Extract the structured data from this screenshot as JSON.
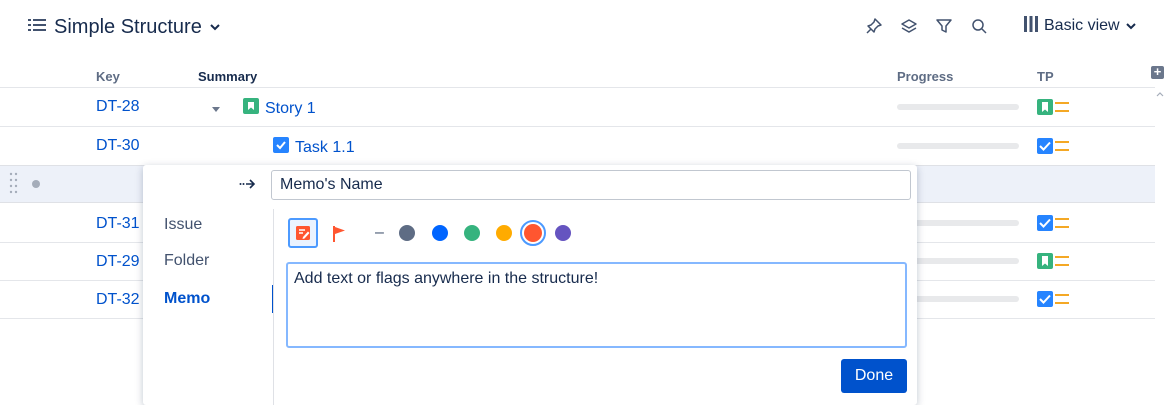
{
  "header": {
    "title": "Simple Structure",
    "view_label": "Basic view"
  },
  "columns": {
    "key": "Key",
    "summary": "Summary",
    "progress": "Progress",
    "tp": "TP"
  },
  "rows": [
    {
      "key": "DT-28",
      "summary": "Story 1",
      "type": "story",
      "progress": 0
    },
    {
      "key": "DT-30",
      "summary": "Task 1.1",
      "type": "task",
      "progress": 0
    },
    {
      "key": "DT-31",
      "type": "task",
      "progress": 0
    },
    {
      "key": "DT-29",
      "type": "story",
      "progress": 0
    },
    {
      "key": "DT-32",
      "type": "task",
      "progress": 0
    }
  ],
  "popup": {
    "name_value": "Memo's Name",
    "tabs": [
      "Issue",
      "Folder",
      "Memo"
    ],
    "active_tab": "Memo",
    "memo_text": "Add text or flags anywhere in the structure!",
    "no_color_label": "–",
    "colors": [
      "#5e6c84",
      "#0065ff",
      "#36b37e",
      "#ffab00",
      "#ff5630",
      "#6554c0"
    ],
    "selected_color": "#ff5630",
    "done_label": "Done"
  },
  "icons": {
    "header": [
      "structure-list-icon",
      "chevron-down-icon"
    ],
    "toolbar": [
      "pin-icon",
      "layers-icon",
      "filter-icon",
      "search-icon",
      "columns-icon"
    ],
    "type_colors": {
      "story": "#36b37e",
      "task": "#2684ff"
    }
  }
}
